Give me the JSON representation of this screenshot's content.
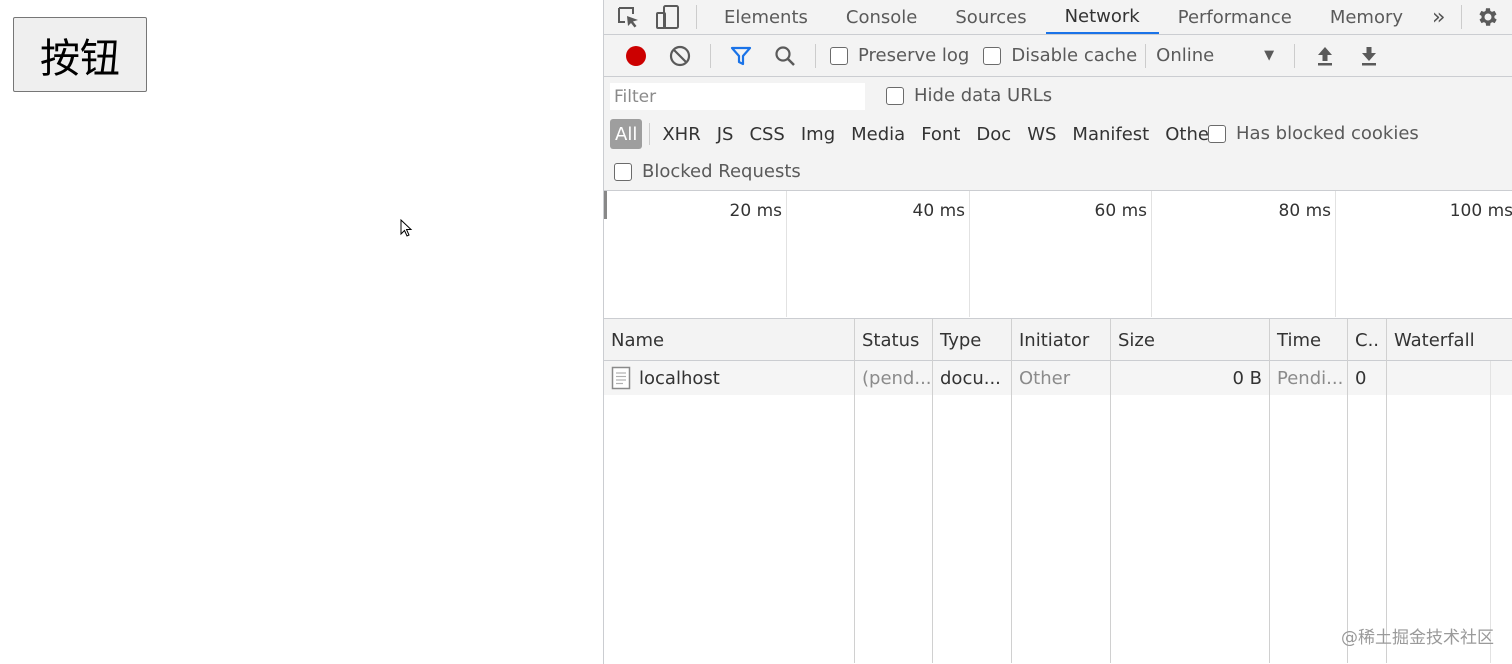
{
  "page": {
    "button_label": "按钮"
  },
  "devtools": {
    "tabs": [
      "Elements",
      "Console",
      "Sources",
      "Network",
      "Performance",
      "Memory"
    ],
    "active_tab": "Network",
    "more_tabs": "»",
    "toolbar": {
      "preserve_log": "Preserve log",
      "disable_cache": "Disable cache",
      "throttle_value": "Online",
      "record_color": "#cc0000",
      "filter_icon_color": "#1a73e8"
    },
    "filter": {
      "placeholder": "Filter",
      "hide_data_urls": "Hide data URLs",
      "types": [
        "All",
        "XHR",
        "JS",
        "CSS",
        "Img",
        "Media",
        "Font",
        "Doc",
        "WS",
        "Manifest",
        "Other"
      ],
      "has_blocked_cookies": "Has blocked cookies",
      "blocked_requests": "Blocked Requests"
    },
    "overview": {
      "ticks": [
        "20 ms",
        "40 ms",
        "60 ms",
        "80 ms",
        "100 ms"
      ]
    },
    "table": {
      "columns": [
        "Name",
        "Status",
        "Type",
        "Initiator",
        "Size",
        "Time",
        "C..",
        "Waterfall"
      ],
      "rows": [
        {
          "name": "localhost",
          "status": "(pend...",
          "type": "docu...",
          "initiator": "Other",
          "size": "0 B",
          "time": "Pendi...",
          "c": "0"
        }
      ]
    }
  },
  "watermark": "@稀土掘金技术社区"
}
